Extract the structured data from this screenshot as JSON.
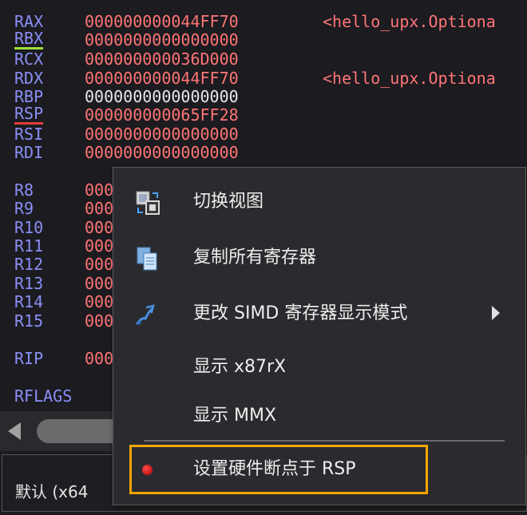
{
  "registers": [
    {
      "name": "RAX",
      "value": "000000000044FF70",
      "comment": "<hello_upx.Optiona"
    },
    {
      "name": "RBX",
      "value": "0000000000000000",
      "comment": ""
    },
    {
      "name": "RCX",
      "value": "000000000036D000",
      "comment": ""
    },
    {
      "name": "RDX",
      "value": "000000000044FF70",
      "comment": "<hello_upx.Optiona"
    },
    {
      "name": "RBP",
      "value": "0000000000000000",
      "comment": ""
    },
    {
      "name": "RSP",
      "value": "000000000065FF28",
      "comment": ""
    },
    {
      "name": "RSI",
      "value": "0000000000000000",
      "comment": ""
    },
    {
      "name": "RDI",
      "value": "0000000000000000",
      "comment": ""
    },
    {
      "name": "R8",
      "value": "000",
      "comment": ""
    },
    {
      "name": "R9",
      "value": "000",
      "comment": ""
    },
    {
      "name": "R10",
      "value": "000",
      "comment": ""
    },
    {
      "name": "R11",
      "value": "000",
      "comment": ""
    },
    {
      "name": "R12",
      "value": "000",
      "comment": ""
    },
    {
      "name": "R13",
      "value": "000",
      "comment": ""
    },
    {
      "name": "R14",
      "value": "000",
      "comment": ""
    },
    {
      "name": "R15",
      "value": "000",
      "comment": ""
    },
    {
      "name": "RIP",
      "value": "000",
      "comment": ""
    },
    {
      "name": "RFLAGS",
      "value": "",
      "comment": ""
    }
  ],
  "status_bar": {
    "text": "默认 (x64"
  },
  "context_menu": {
    "items": [
      {
        "label": "切换视图",
        "icon": "switch-view-icon"
      },
      {
        "label": "复制所有寄存器",
        "icon": "copy-icon"
      },
      {
        "label": "更改 SIMD 寄存器显示模式",
        "icon": "simd-mode-icon",
        "has_submenu": true
      },
      {
        "label": "显示 x87rX"
      },
      {
        "label": "显示 MMX"
      },
      {
        "label": "设置硬件断点于 RSP",
        "icon": "breakpoint-dot-icon",
        "highlighted": true
      }
    ]
  },
  "colors": {
    "register_name": "#8a8ff5",
    "register_value": "#ff7575",
    "highlight_border": "#f0a500",
    "menu_background": "#2b2b2f"
  }
}
